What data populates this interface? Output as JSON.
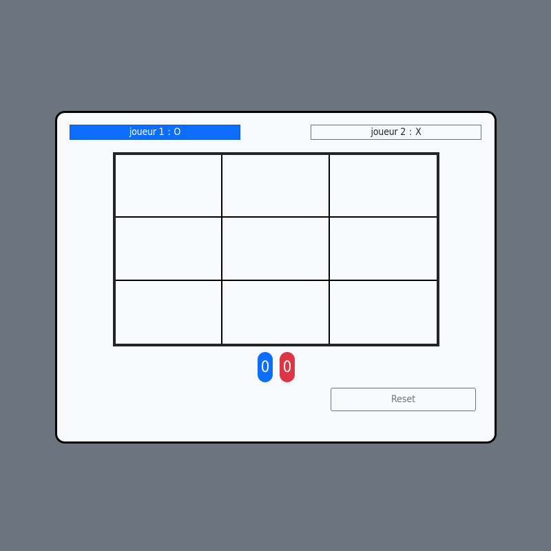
{
  "players": [
    {
      "label": "joueur 1",
      "separator": ":",
      "symbol": "O",
      "color": "#0d6efd",
      "active": true
    },
    {
      "label": "joueur 2",
      "separator": ":",
      "symbol": "X",
      "color": "#f8f9fa",
      "active": false
    }
  ],
  "board": {
    "cells": [
      "",
      "",
      "",
      "",
      "",
      "",
      "",
      "",
      ""
    ]
  },
  "scores": [
    {
      "value": "0",
      "color": "#0d6efd"
    },
    {
      "value": "0",
      "color": "#dc3545"
    }
  ],
  "reset": {
    "label": "Reset"
  },
  "colors": {
    "background": "#6c757d",
    "card": "#f8f9fa",
    "board_border": "#212529"
  }
}
